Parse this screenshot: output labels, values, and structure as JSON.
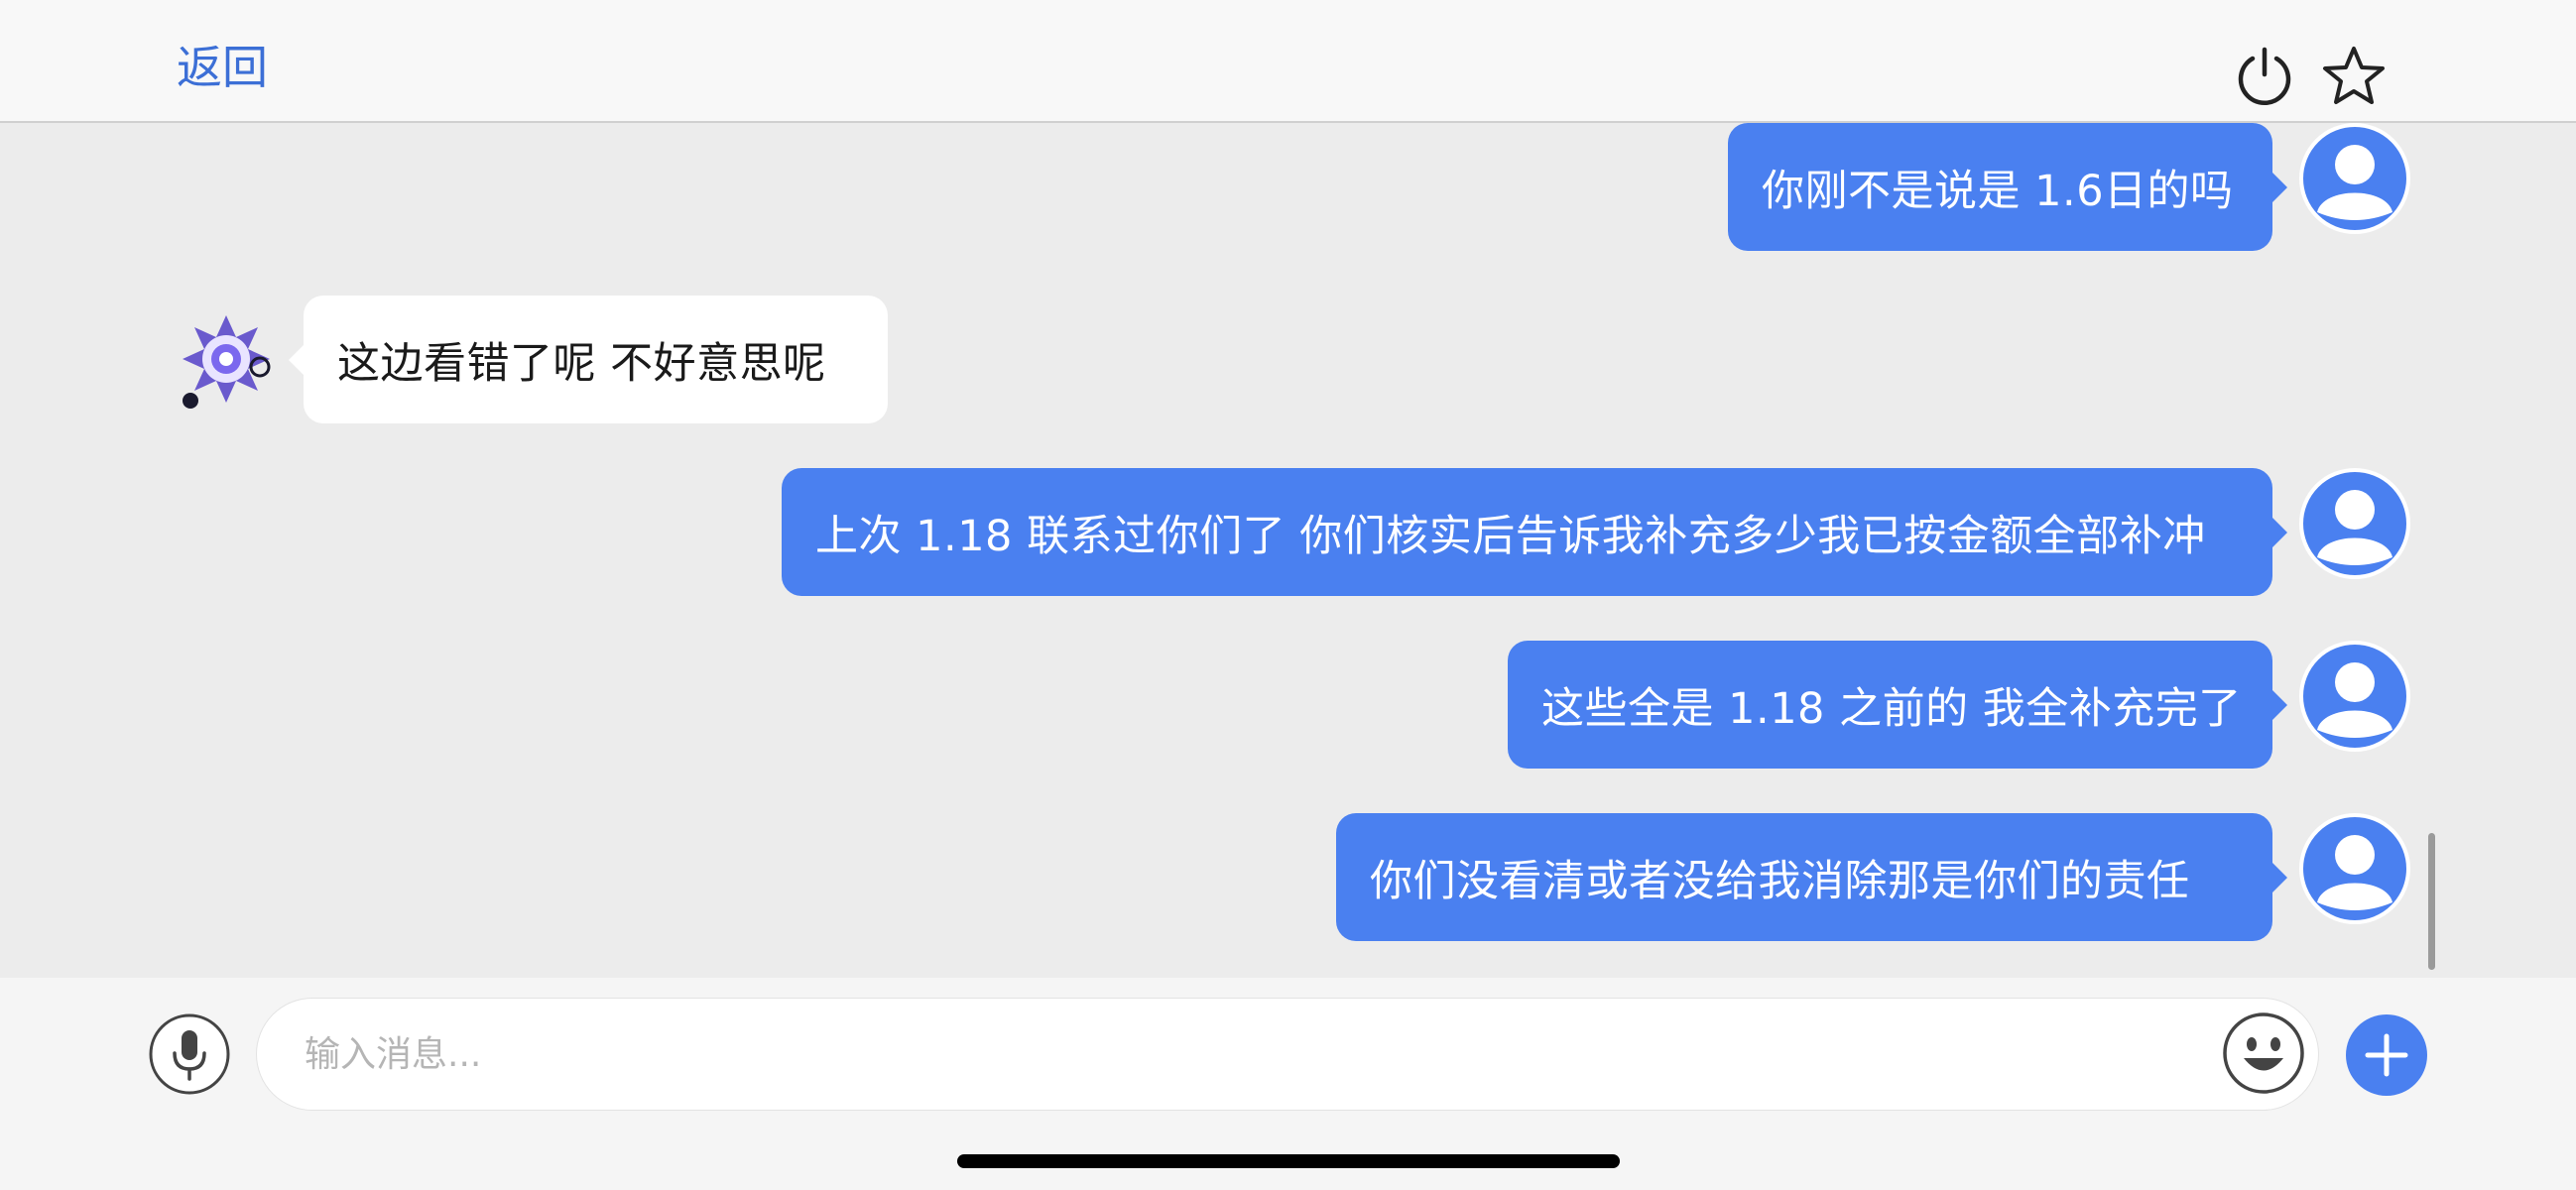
{
  "header": {
    "back_label": "返回",
    "power_icon": "power-icon",
    "star_icon": "star-icon"
  },
  "messages": [
    {
      "direction": "outgoing",
      "text": "你刚不是说是 1.6日的吗"
    },
    {
      "direction": "incoming",
      "text": "这边看错了呢 不好意思呢"
    },
    {
      "direction": "outgoing",
      "text": "上次 1.18 联系过你们了 你们核实后告诉我补充多少我已按金额全部补冲"
    },
    {
      "direction": "outgoing",
      "text": "这些全是 1.18 之前的 我全补充完了"
    },
    {
      "direction": "outgoing",
      "text": "你们没看清或者没给我消除那是你们的责任"
    }
  ],
  "input": {
    "placeholder": "输入消息...",
    "value": "",
    "mic_icon": "microphone-icon",
    "emoji_icon": "emoji-icon",
    "plus_icon": "plus-icon"
  },
  "colors": {
    "accent": "#4a80f0",
    "link": "#3c6fd6",
    "chat_background": "#ececec",
    "header_background": "#f8f8f8"
  }
}
